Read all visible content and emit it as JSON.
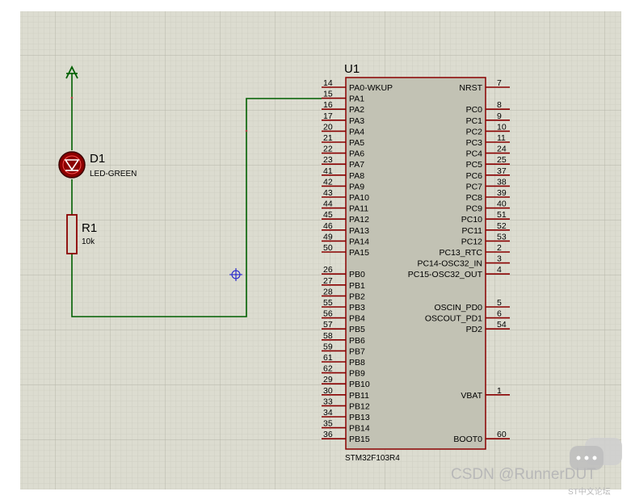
{
  "chip": {
    "ref": "U1",
    "part": "STM32F103R4",
    "left_pins": [
      {
        "num": "14",
        "name": "PA0-WKUP"
      },
      {
        "num": "15",
        "name": "PA1"
      },
      {
        "num": "16",
        "name": "PA2"
      },
      {
        "num": "17",
        "name": "PA3"
      },
      {
        "num": "20",
        "name": "PA4"
      },
      {
        "num": "21",
        "name": "PA5"
      },
      {
        "num": "22",
        "name": "PA6"
      },
      {
        "num": "23",
        "name": "PA7"
      },
      {
        "num": "41",
        "name": "PA8"
      },
      {
        "num": "42",
        "name": "PA9"
      },
      {
        "num": "43",
        "name": "PA10"
      },
      {
        "num": "44",
        "name": "PA11"
      },
      {
        "num": "45",
        "name": "PA12"
      },
      {
        "num": "46",
        "name": "PA13"
      },
      {
        "num": "49",
        "name": "PA14"
      },
      {
        "num": "50",
        "name": "PA15"
      },
      null,
      {
        "num": "26",
        "name": "PB0"
      },
      {
        "num": "27",
        "name": "PB1"
      },
      {
        "num": "28",
        "name": "PB2"
      },
      {
        "num": "55",
        "name": "PB3"
      },
      {
        "num": "56",
        "name": "PB4"
      },
      {
        "num": "57",
        "name": "PB5"
      },
      {
        "num": "58",
        "name": "PB6"
      },
      {
        "num": "59",
        "name": "PB7"
      },
      {
        "num": "61",
        "name": "PB8"
      },
      {
        "num": "62",
        "name": "PB9"
      },
      {
        "num": "29",
        "name": "PB10"
      },
      {
        "num": "30",
        "name": "PB11"
      },
      {
        "num": "33",
        "name": "PB12"
      },
      {
        "num": "34",
        "name": "PB13"
      },
      {
        "num": "35",
        "name": "PB14"
      },
      {
        "num": "36",
        "name": "PB15"
      }
    ],
    "right_pins": [
      {
        "num": "7",
        "name": "NRST"
      },
      null,
      {
        "num": "8",
        "name": "PC0"
      },
      {
        "num": "9",
        "name": "PC1"
      },
      {
        "num": "10",
        "name": "PC2"
      },
      {
        "num": "11",
        "name": "PC3"
      },
      {
        "num": "24",
        "name": "PC4"
      },
      {
        "num": "25",
        "name": "PC5"
      },
      {
        "num": "37",
        "name": "PC6"
      },
      {
        "num": "38",
        "name": "PC7"
      },
      {
        "num": "39",
        "name": "PC8"
      },
      {
        "num": "40",
        "name": "PC9"
      },
      {
        "num": "51",
        "name": "PC10"
      },
      {
        "num": "52",
        "name": "PC11"
      },
      {
        "num": "53",
        "name": "PC12"
      },
      {
        "num": "2",
        "name": "PC13_RTC"
      },
      {
        "num": "3",
        "name": "PC14-OSC32_IN"
      },
      {
        "num": "4",
        "name": "PC15-OSC32_OUT"
      },
      null,
      null,
      {
        "num": "5",
        "name": "OSCIN_PD0"
      },
      {
        "num": "6",
        "name": "OSCOUT_PD1"
      },
      {
        "num": "54",
        "name": "PD2"
      },
      null,
      null,
      null,
      null,
      null,
      {
        "num": "1",
        "name": "VBAT"
      },
      null,
      null,
      null,
      {
        "num": "60",
        "name": "BOOT0"
      }
    ]
  },
  "led": {
    "ref": "D1",
    "value": "LED-GREEN"
  },
  "resistor": {
    "ref": "R1",
    "value": "10k"
  },
  "watermark": {
    "text": "CSDN @RunnerDUT",
    "corner": "ST中文论坛"
  },
  "colors": {
    "grid_bg": "#dcdcd0",
    "grid_minor": "#c6c6ba",
    "grid_major": "#b4b4a8",
    "chip_fill": "#c2c2b4",
    "chip_border": "#000000",
    "pin": "#8a0000",
    "wire": "#005f00",
    "led_body": "#8b0000",
    "probe": "#2222cc"
  }
}
